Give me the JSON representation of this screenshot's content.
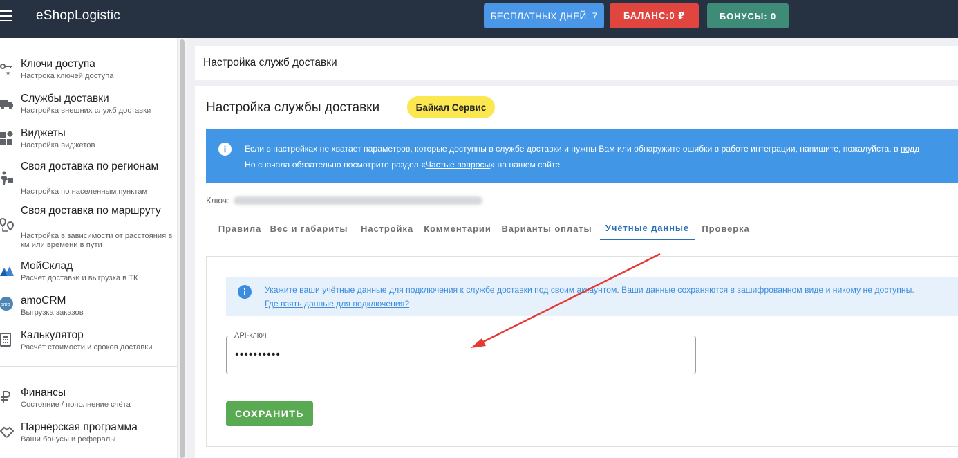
{
  "topbar": {
    "brand": "eShopLogistic",
    "days_label": "БЕСПЛАТНЫХ ДНЕЙ: 7",
    "balance_label": "БАЛАНС:0 ₽",
    "bonus_label": "БОНУСЫ: 0",
    "colors": {
      "bar": "#263142",
      "days": "#4a97e8",
      "balance": "#e0453f",
      "bonus": "#3e8b78"
    }
  },
  "sidebar": {
    "items": [
      {
        "title": "Ключи доступа",
        "subtitle": "Настрока ключей доступа",
        "icon": "key-icon"
      },
      {
        "title": "Службы доставки",
        "subtitle": "Настройка внешних служб доставки",
        "icon": "truck-icon"
      },
      {
        "title": "Виджеты",
        "subtitle": "Настройка виджетов",
        "icon": "widgets-icon"
      },
      {
        "title": "Своя доставка по регионам",
        "subtitle": "Настройка по населенным пунктам",
        "icon": "courier-icon"
      },
      {
        "title": "Своя доставка по маршруту",
        "subtitle": "Настройка в зависимости от расстояния в км или времени в пути",
        "icon": "route-icon"
      },
      {
        "title": "МойСклад",
        "subtitle": "Расчет доставки и выгрузка в ТК",
        "icon": "moysklad-icon"
      },
      {
        "title": "amoCRM",
        "subtitle": "Выгрузка заказов",
        "icon": "amocrm-icon"
      },
      {
        "title": "Калькулятор",
        "subtitle": "Расчёт стоимости и сроков доставки",
        "icon": "calculator-icon"
      },
      {
        "title": "Финансы",
        "subtitle": "Состояние / пополнение счёта",
        "icon": "ruble-icon"
      },
      {
        "title": "Парнёрская программа",
        "subtitle": "Ваши бонусы и рефералы",
        "icon": "handshake-icon"
      }
    ]
  },
  "header": {
    "title": "Настройка служб доставки"
  },
  "page": {
    "title": "Настройка службы доставки",
    "badge": "Байкал Сервис",
    "info": {
      "line1": "Если в настройках не хватает параметров, которые доступны в службе доставки и нужны Вам или обнаружите ошибки в работе интеграции, напишите, пожалуйста, в",
      "line1_link": "подд",
      "line2_pre": "Но сначала обязательно посмотрите раздел «",
      "line2_link": "Частые вопросы",
      "line2_post": "» на нашем сайте."
    },
    "key_label": "Ключ:",
    "tabs": [
      "Правила",
      "Вес и габариты",
      "Настройка",
      "Комментарии",
      "Варианты оплаты",
      "Учётные данные",
      "Проверка"
    ],
    "active_tab": "Учётные данные"
  },
  "credentials": {
    "info_line1": "Укажите ваши учётные данные для подключения к службе доставки под своим аккаунтом. Ваши данные сохраняются в зашифрованном виде и никому не доступны.",
    "info_link": "Где взять данные для подключения?",
    "field_label": "API-ключ",
    "field_value": "••••••••••",
    "save_label": "СОХРАНИТЬ"
  }
}
